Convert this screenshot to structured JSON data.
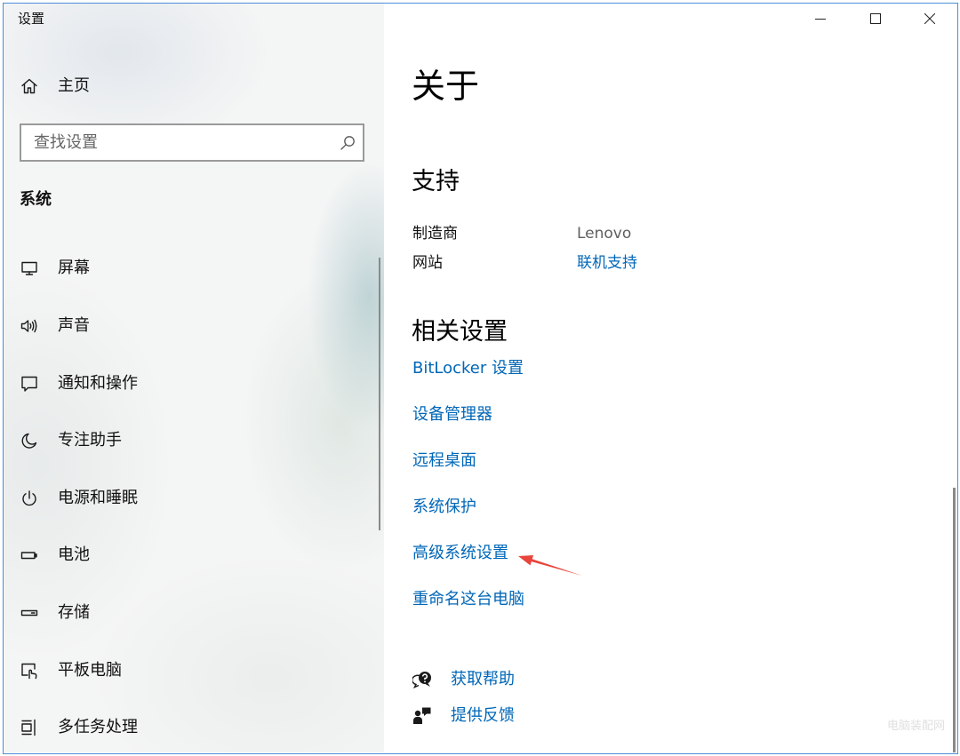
{
  "window": {
    "title": "设置",
    "controls": [
      {
        "name": "minimize",
        "icon": "minimize-icon"
      },
      {
        "name": "maximize",
        "icon": "maximize-icon"
      },
      {
        "name": "close",
        "icon": "close-icon"
      }
    ]
  },
  "sidebar": {
    "home": {
      "label": "主页",
      "icon": "home-icon"
    },
    "search": {
      "placeholder": "查找设置",
      "value": "",
      "icon": "search-icon"
    },
    "section_title": "系统",
    "items": [
      {
        "label": "屏幕",
        "icon": "display-icon"
      },
      {
        "label": "声音",
        "icon": "sound-icon"
      },
      {
        "label": "通知和操作",
        "icon": "notification-icon"
      },
      {
        "label": "专注助手",
        "icon": "moon-icon"
      },
      {
        "label": "电源和睡眠",
        "icon": "power-icon"
      },
      {
        "label": "电池",
        "icon": "battery-icon"
      },
      {
        "label": "存储",
        "icon": "storage-icon"
      },
      {
        "label": "平板电脑",
        "icon": "tablet-icon"
      },
      {
        "label": "多任务处理",
        "icon": "multitasking-icon"
      }
    ]
  },
  "main": {
    "title": "关于",
    "support": {
      "heading": "支持",
      "rows": [
        {
          "label": "制造商",
          "value": "Lenovo"
        },
        {
          "label": "网站",
          "value": "联机支持",
          "is_link": true
        }
      ]
    },
    "related_settings": {
      "heading": "相关设置",
      "links": [
        "BitLocker 设置",
        "设备管理器",
        "远程桌面",
        "系统保护",
        "高级系统设置",
        "重命名这台电脑"
      ]
    },
    "help": [
      {
        "label": "获取帮助",
        "icon": "get-help-icon"
      },
      {
        "label": "提供反馈",
        "icon": "feedback-icon"
      }
    ]
  },
  "annotation_arrow": {
    "icon": "red-arrow-icon",
    "color": "#e8453c"
  },
  "watermark": "电脑装配网",
  "colors": {
    "link": "#0067b8",
    "window_border": "#4a8fd8",
    "secondary_text": "#5f5f5f",
    "annotation_arrow": "#e8453c"
  }
}
